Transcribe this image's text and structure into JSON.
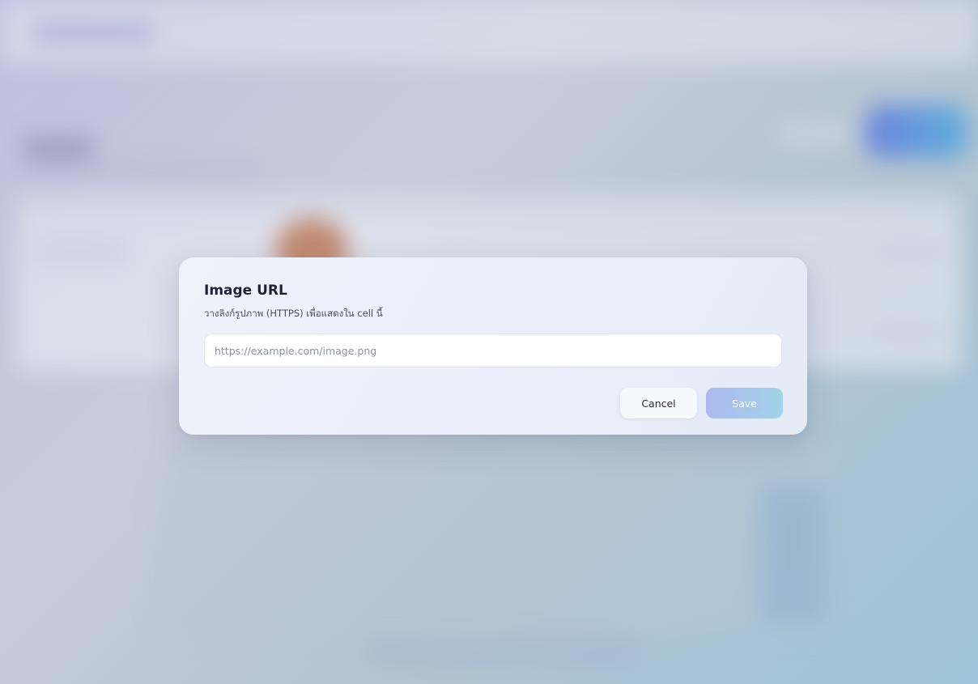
{
  "dialog": {
    "title": "Image URL",
    "description": "วางลิงก์รูปภาพ (HTTPS) เพื่อแสดงใน cell นี้",
    "input": {
      "value": "",
      "placeholder": "https://example.com/image.png"
    },
    "cancel_label": "Cancel",
    "save_label": "Save",
    "save_disabled": true
  },
  "colors": {
    "save_gradient_start": "#a9b6f0",
    "save_gradient_end": "#9fd2e6",
    "background_accent": "#5874d8"
  }
}
